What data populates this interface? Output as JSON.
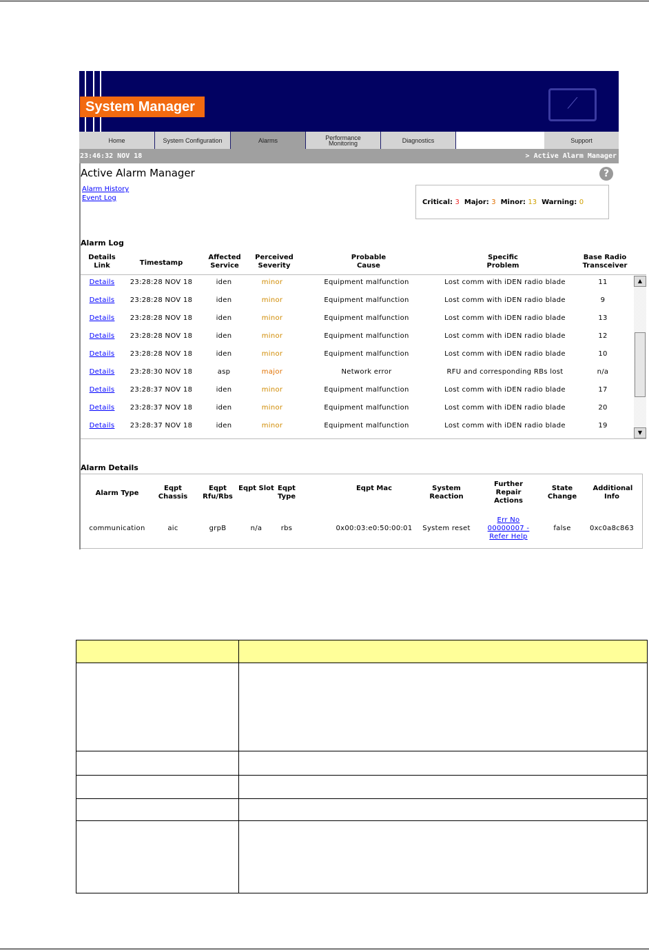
{
  "app": {
    "title": "System Manager",
    "clock": "23:46:32 NOV 18",
    "breadcrumb": "> Active Alarm Manager"
  },
  "tabs": [
    {
      "label": "Home"
    },
    {
      "label": "System Configuration"
    },
    {
      "label": "Alarms"
    },
    {
      "label": "Performance Monitoring"
    },
    {
      "label": "Diagnostics"
    },
    {
      "label": "Support"
    }
  ],
  "page": {
    "title": "Active Alarm Manager",
    "help_icon": "question-icon",
    "links": [
      "Alarm History",
      "Event Log"
    ]
  },
  "summary": {
    "critical_label": "Critical:",
    "critical": "3",
    "major_label": "Major:",
    "major": "3",
    "minor_label": "Minor:",
    "minor": "13",
    "warning_label": "Warning:",
    "warning": "0",
    "colors": {
      "critical": "#ee2222",
      "major": "#e07000",
      "minor": "#d0a000",
      "warning": "#d0a000"
    }
  },
  "alarm_log": {
    "title": "Alarm Log",
    "headers": [
      "Details Link",
      "Timestamp",
      "Affected Service",
      "Perceived Severity",
      "Probable Cause",
      "Specific Problem",
      "Base Radio Transceiver"
    ],
    "rows": [
      [
        "Details",
        "23:28:28 NOV 18",
        "iden",
        "minor",
        "Equipment malfunction",
        "Lost comm with iDEN radio blade",
        "11"
      ],
      [
        "Details",
        "23:28:28 NOV 18",
        "iden",
        "minor",
        "Equipment malfunction",
        "Lost comm with iDEN radio blade",
        "9"
      ],
      [
        "Details",
        "23:28:28 NOV 18",
        "iden",
        "minor",
        "Equipment malfunction",
        "Lost comm with iDEN radio blade",
        "13"
      ],
      [
        "Details",
        "23:28:28 NOV 18",
        "iden",
        "minor",
        "Equipment malfunction",
        "Lost comm with iDEN radio blade",
        "12"
      ],
      [
        "Details",
        "23:28:28 NOV 18",
        "iden",
        "minor",
        "Equipment malfunction",
        "Lost comm with iDEN radio blade",
        "10"
      ],
      [
        "Details",
        "23:28:30 NOV 18",
        "asp",
        "major",
        "Network error",
        "RFU and corresponding RBs lost",
        "n/a"
      ],
      [
        "Details",
        "23:28:37 NOV 18",
        "iden",
        "minor",
        "Equipment malfunction",
        "Lost comm with iDEN radio blade",
        "17"
      ],
      [
        "Details",
        "23:28:37 NOV 18",
        "iden",
        "minor",
        "Equipment malfunction",
        "Lost comm with iDEN radio blade",
        "20"
      ],
      [
        "Details",
        "23:28:37 NOV 18",
        "iden",
        "minor",
        "Equipment malfunction",
        "Lost comm with iDEN radio blade",
        "19"
      ]
    ]
  },
  "alarm_details": {
    "title": "Alarm Details",
    "headers": [
      "Alarm Type",
      "Eqpt Chassis",
      "Eqpt Rfu/Rbs",
      "Eqpt Slot",
      "Eqpt Type",
      "Eqpt Mac",
      "System Reaction",
      "Further Repair Actions",
      "State Change",
      "Additional Info"
    ],
    "values": [
      "communication",
      "aic",
      "grpB",
      "n/a",
      "rbs",
      "0x00:03:e0:50:00:01",
      "System reset",
      "Err No 00000007 - Refer Help",
      "false",
      "0xc0a8c863"
    ]
  }
}
